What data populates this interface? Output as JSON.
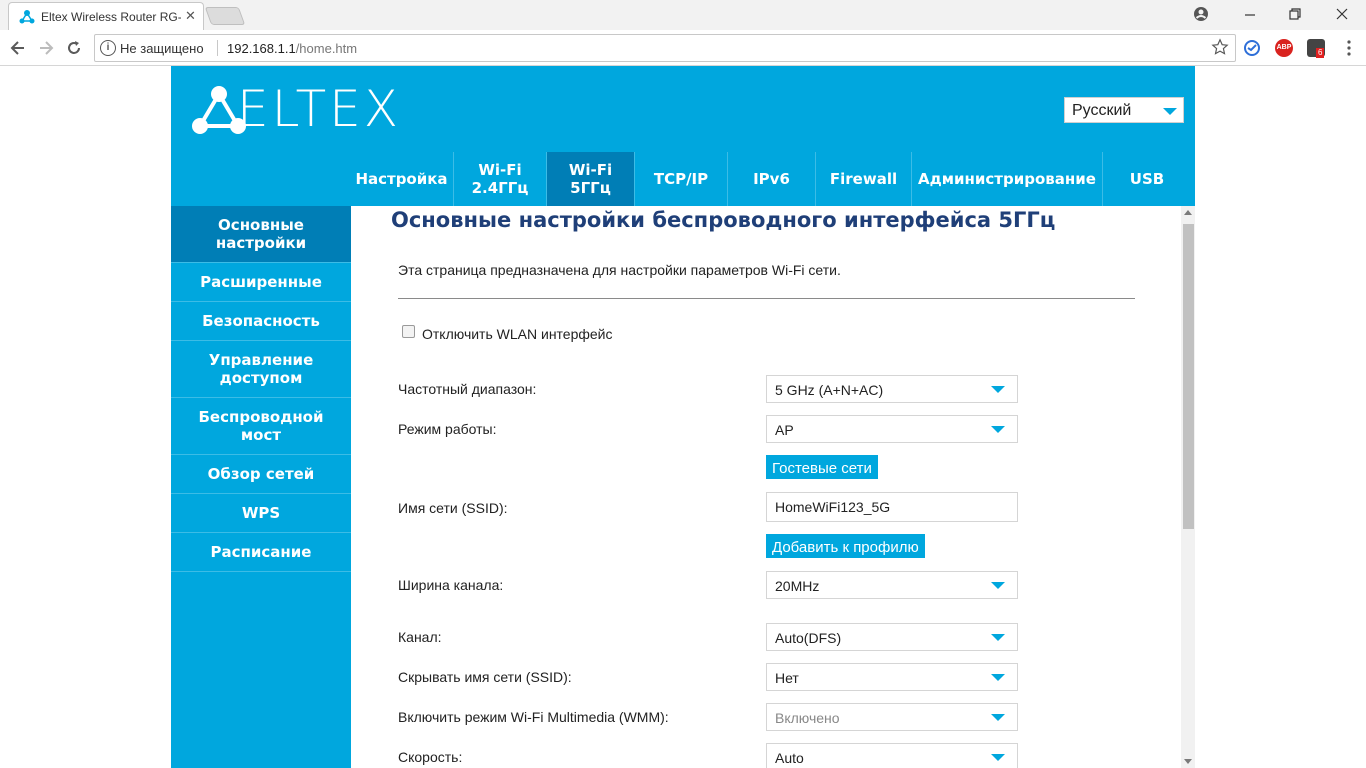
{
  "browser": {
    "tab_title": "Eltex Wireless Router RG-",
    "tab_close": "✕",
    "security_label": "Не защищено",
    "url_host": "192.168.1.1",
    "url_path": "/home.htm",
    "abp_label": "ABP",
    "ext_badge": "6"
  },
  "header": {
    "logo_text": "ELTEX",
    "language": "Русский",
    "nav": [
      {
        "label": "Настройка"
      },
      {
        "label": "Wi-Fi\n2.4ГГц"
      },
      {
        "label": "Wi-Fi\n5ГГц"
      },
      {
        "label": "TCP/IP"
      },
      {
        "label": "IPv6"
      },
      {
        "label": "Firewall"
      },
      {
        "label": "Администрирование"
      },
      {
        "label": "USB"
      }
    ]
  },
  "sidebar": {
    "items": [
      {
        "label": "Основные настройки"
      },
      {
        "label": "Расширенные"
      },
      {
        "label": "Безопасность"
      },
      {
        "label": "Управление доступом"
      },
      {
        "label": "Беспроводной мост"
      },
      {
        "label": "Обзор сетей"
      },
      {
        "label": "WPS"
      },
      {
        "label": "Расписание"
      }
    ]
  },
  "main": {
    "title": "Основные настройки беспроводного интерфейса 5ГГц",
    "description": "Эта страница предназначена для настройки параметров Wi-Fi сети.",
    "disable_wlan_label": "Отключить WLAN интерфейс",
    "rows": {
      "band": {
        "label": "Частотный диапазон:",
        "value": "5 GHz (A+N+AC)"
      },
      "mode": {
        "label": "Режим работы:",
        "value": "AP"
      },
      "guest_button": "Гостевые сети",
      "ssid": {
        "label": "Имя сети (SSID):",
        "value": "HomeWiFi123_5G"
      },
      "add_profile_button": "Добавить к профилю",
      "width": {
        "label": "Ширина канала:",
        "value": "20MHz"
      },
      "channel": {
        "label": "Канал:",
        "value": "Auto(DFS)"
      },
      "hide_ssid": {
        "label": "Скрывать имя сети (SSID):",
        "value": "Нет"
      },
      "wmm": {
        "label": "Включить режим Wi-Fi Multimedia (WMM):",
        "value": "Включено"
      },
      "speed": {
        "label": "Скорость:",
        "value": "Auto"
      }
    }
  },
  "colors": {
    "brand": "#00a7de",
    "active_nav": "#007eb6",
    "title": "#1f3f78"
  }
}
